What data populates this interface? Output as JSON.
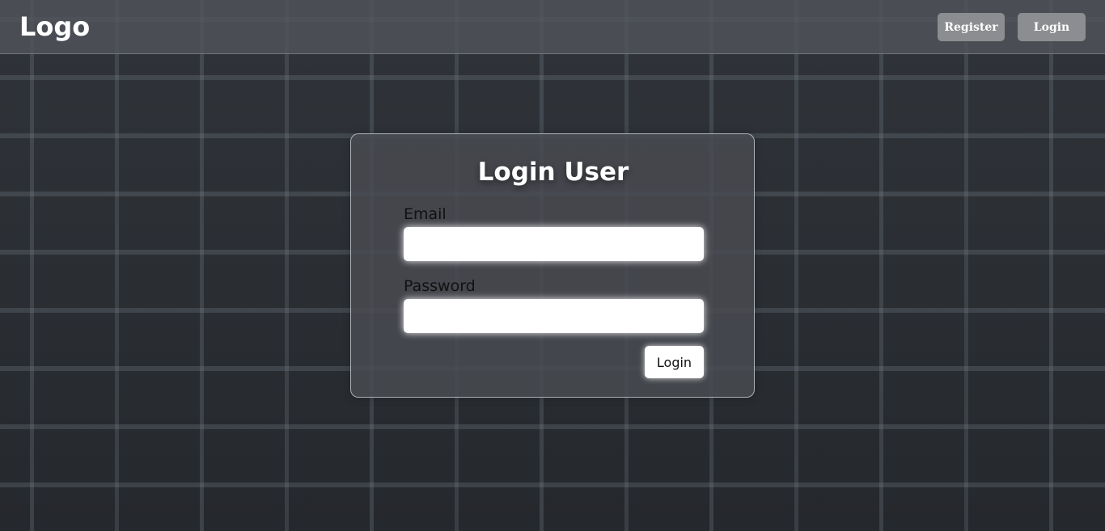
{
  "header": {
    "logo_text": "Logo",
    "register_label": "Register",
    "login_label": "Login"
  },
  "login_card": {
    "title": "Login User",
    "email_label": "Email",
    "email_value": "",
    "password_label": "Password",
    "password_value": "",
    "submit_label": "Login"
  },
  "colors": {
    "navbar_background": "#50545a",
    "nav_button_background": "#8b8d90",
    "card_background": "#484b50",
    "input_background": "#ffffff",
    "title_text": "#ffffff"
  },
  "icons": {
    "background_texture": "brick-wall-background"
  }
}
